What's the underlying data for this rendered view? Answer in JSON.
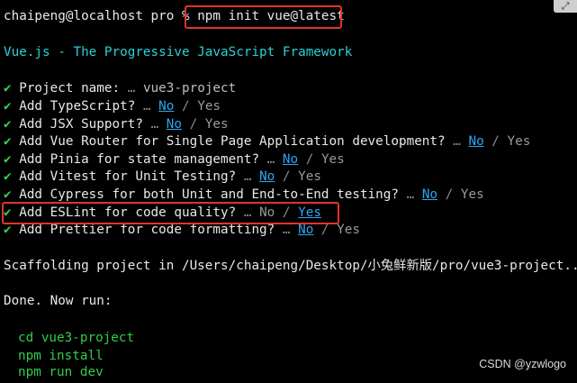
{
  "prompt": {
    "text": "chaipeng@localhost pro % ",
    "command": "npm init vue@latest"
  },
  "header": "Vue.js - The Progressive JavaScript Framework",
  "checkmark": "✔",
  "ellipsis": "…",
  "separator": " / ",
  "project_name": {
    "question": "Project name:",
    "value": "vue3-project"
  },
  "questions": [
    {
      "text": "Add TypeScript?",
      "no": "No",
      "yes": "Yes"
    },
    {
      "text": "Add JSX Support?",
      "no": "No",
      "yes": "Yes"
    },
    {
      "text": "Add Vue Router for Single Page Application development?",
      "no": "No",
      "yes": "Yes"
    },
    {
      "text": "Add Pinia for state management?",
      "no": "No",
      "yes": "Yes"
    },
    {
      "text": "Add Vitest for Unit Testing?",
      "no": "No",
      "yes": "Yes"
    },
    {
      "text": "Add Cypress for both Unit and End-to-End testing?",
      "no": "No",
      "yes": "Yes"
    },
    {
      "text": "Add ESLint for code quality?",
      "no": "No",
      "yes": "Yes"
    },
    {
      "text": "Add Prettier for code formatting?",
      "no": "No",
      "yes": "Yes"
    }
  ],
  "scaffolding": "Scaffolding project in /Users/chaipeng/Desktop/小兔鲜新版/pro/vue3-project..",
  "done": "Done. Now run:",
  "next_commands": [
    "cd vue3-project",
    "npm install",
    "npm run dev"
  ],
  "watermark": "CSDN @yzwlogo",
  "corner_icon": "expand-icon"
}
